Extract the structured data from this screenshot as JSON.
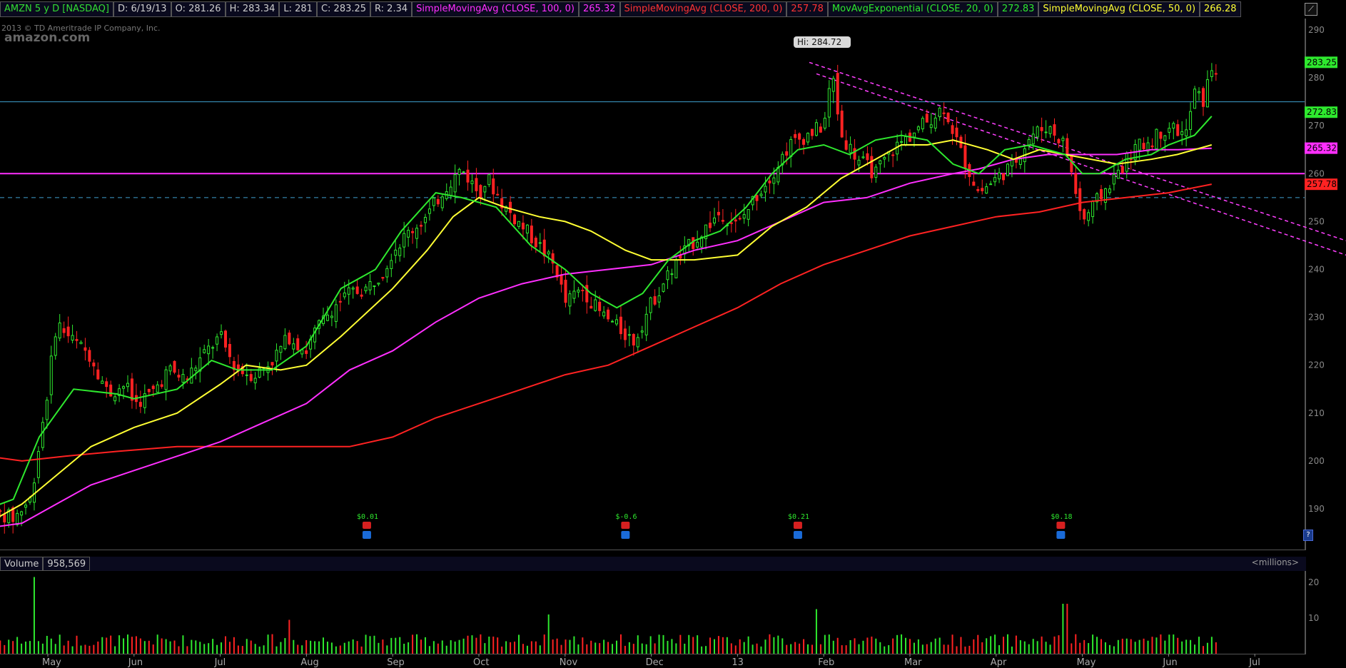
{
  "header": {
    "symbol": "AMZN 5 y D [NASDAQ]",
    "date": "D: 6/19/13",
    "open": "O: 281.26",
    "high": "H: 283.34",
    "low": "L: 281",
    "close": "C: 283.25",
    "range": "R: 2.34",
    "studies": [
      {
        "label": "SimpleMovingAvg (CLOSE, 100, 0)",
        "value": "265.32",
        "color": "#ff2fff"
      },
      {
        "label": "SimpleMovingAvg (CLOSE, 200, 0)",
        "value": "257.78",
        "color": "#ff2222"
      },
      {
        "label": "MovAvgExponential (CLOSE, 20, 0)",
        "value": "272.83",
        "color": "#2ee82e"
      },
      {
        "label": "SimpleMovingAvg (CLOSE, 50, 0)",
        "value": "266.28",
        "color": "#ffff33"
      }
    ]
  },
  "copyright": "2013 © TD Ameritrade IP Company, Inc.",
  "logo_text": "amazon.com",
  "volume": {
    "label": "Volume",
    "value": "958,569",
    "units": "<millions>"
  },
  "icons": {
    "corner": "draw-tool-icon",
    "question": "help-icon"
  },
  "chart_data": {
    "type": "candlestick",
    "x_ticks": [
      "May",
      "Jun",
      "Jul",
      "Aug",
      "Sep",
      "Oct",
      "Nov",
      "Dec",
      "13",
      "Feb",
      "Mar",
      "Apr",
      "May",
      "Jun",
      "Jul"
    ],
    "y_ticks": [
      190,
      200,
      210,
      220,
      230,
      240,
      250,
      260,
      270,
      280,
      290
    ],
    "ylim": [
      184,
      293
    ],
    "hi_label": "Hi: 284.72",
    "hi_value": 284.72,
    "price_labels": [
      {
        "value": 283.25,
        "text": "283.25",
        "color": "#2ee82e"
      },
      {
        "value": 272.83,
        "text": "272.83",
        "color": "#2ee82e"
      },
      {
        "value": 265.32,
        "text": "265.32",
        "color": "#ff2fff"
      },
      {
        "value": 257.78,
        "text": "257.78",
        "color": "#ff2222"
      }
    ],
    "horizontal_lines": [
      {
        "value": 275,
        "color": "#3f9fcf",
        "style": "solid"
      },
      {
        "value": 260,
        "color": "#ff2fff",
        "style": "solid"
      },
      {
        "value": 255,
        "color": "#3f9fcf",
        "style": "dashed"
      }
    ],
    "events": [
      {
        "month_index": 0,
        "text": "",
        "offset": -1.6
      },
      {
        "month_index": 3,
        "text": "$0.01"
      },
      {
        "month_index": 6,
        "text": "$-0.6"
      },
      {
        "month_index": 8,
        "text": "$0.21",
        "offset": 0.7
      },
      {
        "month_index": 11,
        "text": "$0.18",
        "offset": 0.75
      }
    ],
    "ma_keypoints": {
      "ema20": [
        [
          -0.7,
          190
        ],
        [
          -0.4,
          192
        ],
        [
          -0.1,
          205
        ],
        [
          0.3,
          215
        ],
        [
          0.8,
          214
        ],
        [
          1.0,
          213
        ],
        [
          1.5,
          215
        ],
        [
          1.9,
          221
        ],
        [
          2.2,
          219
        ],
        [
          2.6,
          219
        ],
        [
          3.0,
          224
        ],
        [
          3.4,
          236
        ],
        [
          3.8,
          240
        ],
        [
          4.1,
          248
        ],
        [
          4.5,
          256
        ],
        [
          4.8,
          255
        ],
        [
          5.2,
          253
        ],
        [
          5.6,
          245
        ],
        [
          6.0,
          240
        ],
        [
          6.3,
          235
        ],
        [
          6.6,
          232
        ],
        [
          6.9,
          235
        ],
        [
          7.2,
          242
        ],
        [
          7.5,
          246
        ],
        [
          7.8,
          248
        ],
        [
          8.1,
          253
        ],
        [
          8.4,
          260
        ],
        [
          8.7,
          265
        ],
        [
          9.0,
          266
        ],
        [
          9.3,
          264
        ],
        [
          9.6,
          267
        ],
        [
          9.9,
          268
        ],
        [
          10.2,
          267
        ],
        [
          10.5,
          262
        ],
        [
          10.8,
          260
        ],
        [
          11.1,
          265
        ],
        [
          11.4,
          266
        ],
        [
          11.8,
          264
        ],
        [
          12.0,
          260
        ],
        [
          12.2,
          260
        ],
        [
          12.5,
          263
        ],
        [
          12.8,
          264
        ],
        [
          13.0,
          266
        ],
        [
          13.3,
          268
        ],
        [
          13.5,
          272
        ]
      ],
      "sma50": [
        [
          -0.7,
          187
        ],
        [
          -0.3,
          191
        ],
        [
          0.1,
          197
        ],
        [
          0.5,
          203
        ],
        [
          1.0,
          207
        ],
        [
          1.5,
          210
        ],
        [
          2.0,
          216
        ],
        [
          2.3,
          220
        ],
        [
          2.7,
          219
        ],
        [
          3.0,
          220
        ],
        [
          3.4,
          226
        ],
        [
          4.0,
          236
        ],
        [
          4.4,
          244
        ],
        [
          4.7,
          251
        ],
        [
          5.0,
          255
        ],
        [
          5.3,
          253
        ],
        [
          5.7,
          251
        ],
        [
          6.0,
          250
        ],
        [
          6.3,
          248
        ],
        [
          6.7,
          244
        ],
        [
          7.0,
          242
        ],
        [
          7.5,
          242
        ],
        [
          8.0,
          243
        ],
        [
          8.4,
          249
        ],
        [
          8.8,
          253
        ],
        [
          9.2,
          259
        ],
        [
          9.6,
          263
        ],
        [
          9.9,
          266
        ],
        [
          10.2,
          266
        ],
        [
          10.5,
          267
        ],
        [
          10.9,
          265
        ],
        [
          11.2,
          263
        ],
        [
          11.5,
          265
        ],
        [
          11.8,
          264
        ],
        [
          12.1,
          263
        ],
        [
          12.4,
          262
        ],
        [
          12.8,
          263
        ],
        [
          13.1,
          264
        ],
        [
          13.5,
          266
        ]
      ],
      "sma100": [
        [
          -0.7,
          186
        ],
        [
          -0.3,
          187
        ],
        [
          0.1,
          191
        ],
        [
          0.5,
          195
        ],
        [
          1.0,
          198
        ],
        [
          1.5,
          201
        ],
        [
          2.0,
          204
        ],
        [
          2.5,
          208
        ],
        [
          3.0,
          212
        ],
        [
          3.5,
          219
        ],
        [
          4.0,
          223
        ],
        [
          4.5,
          229
        ],
        [
          5.0,
          234
        ],
        [
          5.5,
          237
        ],
        [
          6.0,
          239
        ],
        [
          6.5,
          240
        ],
        [
          7.0,
          241
        ],
        [
          7.5,
          244
        ],
        [
          8.0,
          246
        ],
        [
          8.5,
          250
        ],
        [
          9.0,
          254
        ],
        [
          9.5,
          255
        ],
        [
          10.0,
          258
        ],
        [
          10.5,
          260
        ],
        [
          10.8,
          261
        ],
        [
          11.2,
          263
        ],
        [
          11.6,
          264
        ],
        [
          12.0,
          264
        ],
        [
          12.4,
          264
        ],
        [
          12.8,
          265
        ],
        [
          13.1,
          265
        ],
        [
          13.5,
          265.3
        ]
      ],
      "sma200": [
        [
          -0.7,
          201
        ],
        [
          -0.3,
          200
        ],
        [
          0.2,
          201
        ],
        [
          0.8,
          202
        ],
        [
          1.5,
          203
        ],
        [
          2.3,
          203
        ],
        [
          3.0,
          203
        ],
        [
          3.5,
          203
        ],
        [
          4.0,
          205
        ],
        [
          4.5,
          209
        ],
        [
          5.0,
          212
        ],
        [
          5.5,
          215
        ],
        [
          6.0,
          218
        ],
        [
          6.5,
          220
        ],
        [
          7.0,
          224
        ],
        [
          7.5,
          228
        ],
        [
          8.0,
          232
        ],
        [
          8.5,
          237
        ],
        [
          9.0,
          241
        ],
        [
          9.5,
          244
        ],
        [
          10.0,
          247
        ],
        [
          10.5,
          249
        ],
        [
          11.0,
          251
        ],
        [
          11.5,
          252
        ],
        [
          12.0,
          254
        ],
        [
          12.5,
          255
        ],
        [
          13.0,
          256
        ],
        [
          13.5,
          257.8
        ]
      ]
    },
    "price_path": [
      [
        -0.7,
        190
      ],
      [
        -0.4,
        188
      ],
      [
        -0.2,
        192
      ],
      [
        0.0,
        215
      ],
      [
        0.1,
        229
      ],
      [
        0.3,
        225
      ],
      [
        0.5,
        222
      ],
      [
        0.7,
        214
      ],
      [
        0.9,
        216
      ],
      [
        1.0,
        212
      ],
      [
        1.2,
        214
      ],
      [
        1.4,
        219
      ],
      [
        1.6,
        217
      ],
      [
        1.8,
        222
      ],
      [
        2.0,
        226
      ],
      [
        2.1,
        222
      ],
      [
        2.2,
        219
      ],
      [
        2.4,
        218
      ],
      [
        2.6,
        221
      ],
      [
        2.8,
        226
      ],
      [
        3.0,
        223
      ],
      [
        3.1,
        227
      ],
      [
        3.3,
        232
      ],
      [
        3.5,
        235
      ],
      [
        3.7,
        236
      ],
      [
        3.9,
        240
      ],
      [
        4.0,
        244
      ],
      [
        4.2,
        248
      ],
      [
        4.4,
        251
      ],
      [
        4.6,
        257
      ],
      [
        4.8,
        261
      ],
      [
        5.0,
        256
      ],
      [
        5.1,
        259
      ],
      [
        5.3,
        253
      ],
      [
        5.5,
        249
      ],
      [
        5.7,
        245
      ],
      [
        5.9,
        240
      ],
      [
        6.0,
        233
      ],
      [
        6.2,
        236
      ],
      [
        6.4,
        231
      ],
      [
        6.6,
        228
      ],
      [
        6.8,
        225
      ],
      [
        7.0,
        233
      ],
      [
        7.2,
        239
      ],
      [
        7.4,
        244
      ],
      [
        7.6,
        248
      ],
      [
        7.8,
        252
      ],
      [
        8.0,
        249
      ],
      [
        8.2,
        255
      ],
      [
        8.4,
        260
      ],
      [
        8.6,
        266
      ],
      [
        8.8,
        268
      ],
      [
        9.0,
        270
      ],
      [
        9.1,
        281
      ],
      [
        9.2,
        268
      ],
      [
        9.4,
        263
      ],
      [
        9.6,
        260
      ],
      [
        9.8,
        265
      ],
      [
        10.0,
        268
      ],
      [
        10.2,
        271
      ],
      [
        10.4,
        274
      ],
      [
        10.6,
        264
      ],
      [
        10.8,
        256
      ],
      [
        11.0,
        259
      ],
      [
        11.2,
        262
      ],
      [
        11.4,
        268
      ],
      [
        11.6,
        270
      ],
      [
        11.8,
        266
      ],
      [
        11.9,
        258
      ],
      [
        12.0,
        250
      ],
      [
        12.2,
        255
      ],
      [
        12.4,
        260
      ],
      [
        12.6,
        265
      ],
      [
        12.8,
        267
      ],
      [
        13.0,
        270
      ],
      [
        13.2,
        268
      ],
      [
        13.3,
        277
      ],
      [
        13.4,
        275
      ],
      [
        13.5,
        282
      ]
    ],
    "volume_ticks": [
      10,
      20
    ],
    "volume_ylim": [
      0,
      22
    ],
    "volume_spikes": [
      [
        -0.15,
        21.5
      ],
      [
        2.8,
        9.5
      ],
      [
        5.8,
        11
      ],
      [
        8.9,
        12.5
      ],
      [
        11.8,
        14
      ]
    ]
  }
}
